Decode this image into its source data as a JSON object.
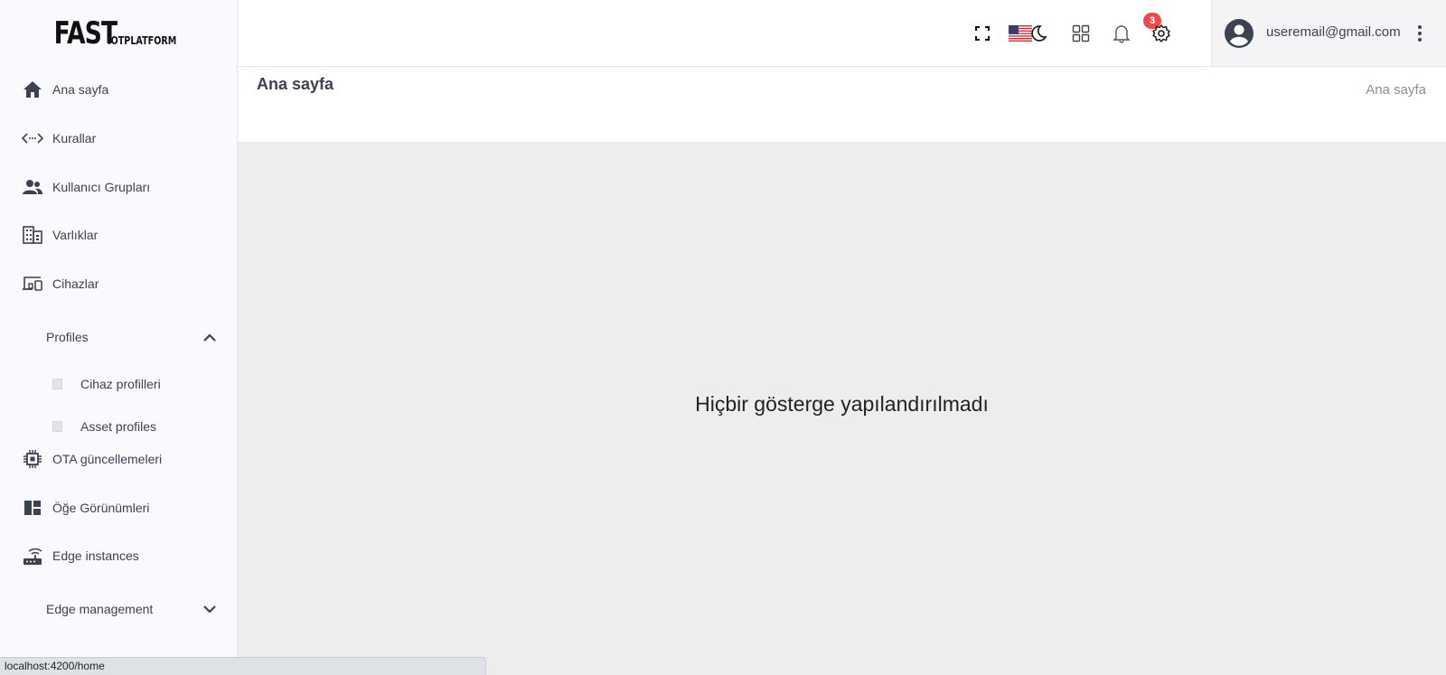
{
  "logo": {
    "big": "FAST",
    "small": "IOTPLATFORM"
  },
  "sidebar": {
    "items": [
      {
        "label": "Ana sayfa",
        "icon": "home-icon"
      },
      {
        "label": "Kurallar",
        "icon": "code-arrows-icon"
      },
      {
        "label": "Kullanıcı Grupları",
        "icon": "users-icon"
      },
      {
        "label": "Varlıklar",
        "icon": "building-icon"
      },
      {
        "label": "Cihazlar",
        "icon": "devices-icon"
      },
      {
        "label": "Profiles",
        "icon": "chevron-up-icon"
      },
      {
        "label": "Cihaz profilleri",
        "icon": "square-icon"
      },
      {
        "label": "Asset profiles",
        "icon": "square-icon"
      },
      {
        "label": "OTA güncellemeleri",
        "icon": "chip-icon"
      },
      {
        "label": "Öğe Görünümleri",
        "icon": "dashboard-layout-icon"
      },
      {
        "label": "Edge instances",
        "icon": "router-icon"
      },
      {
        "label": "Edge management",
        "icon": "chevron-down-icon"
      }
    ]
  },
  "header": {
    "notification_count": "3",
    "user_email": "useremail@gmail.com",
    "icons": [
      "fullscreen-icon",
      "us-flag-icon",
      "moon-icon",
      "grid-apps-icon",
      "bell-icon",
      "gear-icon",
      "account-circle-icon",
      "more-vert-icon"
    ]
  },
  "page": {
    "title": "Ana sayfa",
    "breadcrumb": "Ana sayfa",
    "empty_message": "Hiçbir gösterge yapılandırılmadı"
  },
  "status_bar": {
    "url": "localhost:4200/home"
  },
  "colors": {
    "sidebar_bg": "#f9f9fe",
    "main_bg": "#ededed",
    "badge": "#ef4b4b",
    "text": "#3c4252"
  }
}
